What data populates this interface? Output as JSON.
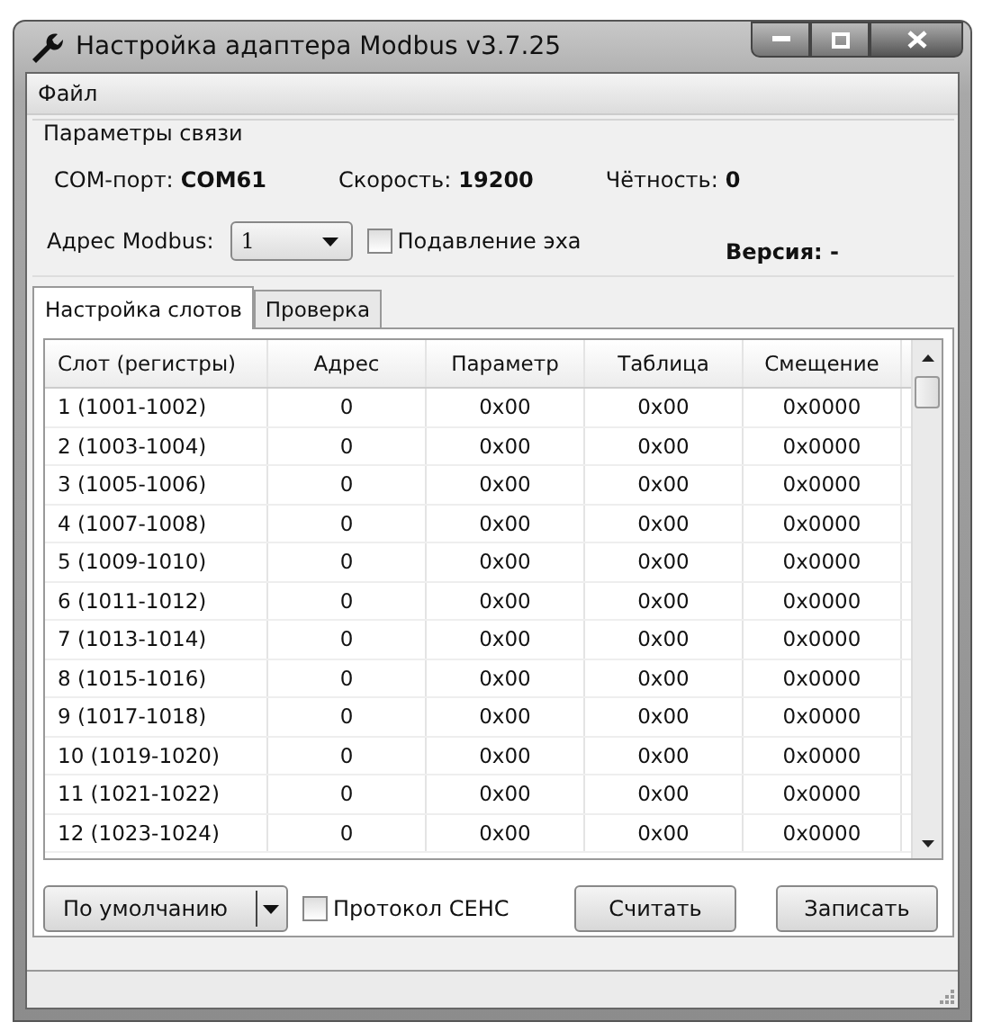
{
  "window": {
    "title": "Настройка адаптера Modbus v3.7.25"
  },
  "menu": [
    "Файл"
  ],
  "connection": {
    "title": "Параметры связи",
    "fields": [
      {
        "label": "COM-порт:",
        "value": "COM61"
      },
      {
        "label": "Скорость:",
        "value": "19200"
      },
      {
        "label": "Чётность:",
        "value": "0"
      }
    ],
    "address": {
      "label": "Адрес Modbus:",
      "value": "1"
    },
    "echo": {
      "label": "Подавление эха",
      "checked": false
    },
    "version": "Версия: -"
  },
  "tabs": [
    {
      "label": "Настройка слотов",
      "selected": true
    },
    {
      "label": "Проверка",
      "selected": false
    }
  ],
  "table": {
    "columns": [
      "Слот (регистры)",
      "Адрес",
      "Параметр",
      "Таблица",
      "Смещение"
    ],
    "rows": [
      [
        "1 (1001-1002)",
        "0",
        "0x00",
        "0x00",
        "0x0000"
      ],
      [
        "2 (1003-1004)",
        "0",
        "0x00",
        "0x00",
        "0x0000"
      ],
      [
        "3 (1005-1006)",
        "0",
        "0x00",
        "0x00",
        "0x0000"
      ],
      [
        "4 (1007-1008)",
        "0",
        "0x00",
        "0x00",
        "0x0000"
      ],
      [
        "5 (1009-1010)",
        "0",
        "0x00",
        "0x00",
        "0x0000"
      ],
      [
        "6 (1011-1012)",
        "0",
        "0x00",
        "0x00",
        "0x0000"
      ],
      [
        "7 (1013-1014)",
        "0",
        "0x00",
        "0x00",
        "0x0000"
      ],
      [
        "8 (1015-1016)",
        "0",
        "0x00",
        "0x00",
        "0x0000"
      ],
      [
        "9 (1017-1018)",
        "0",
        "0x00",
        "0x00",
        "0x0000"
      ],
      [
        "10 (1019-1020)",
        "0",
        "0x00",
        "0x00",
        "0x0000"
      ],
      [
        "11 (1021-1022)",
        "0",
        "0x00",
        "0x00",
        "0x0000"
      ],
      [
        "12 (1023-1024)",
        "0",
        "0x00",
        "0x00",
        "0x0000"
      ]
    ]
  },
  "bottom": {
    "default_button": "По умолчанию",
    "protocol": {
      "label": "Протокол СЕНС",
      "checked": false
    },
    "read_button": "Считать",
    "write_button": "Записать"
  }
}
